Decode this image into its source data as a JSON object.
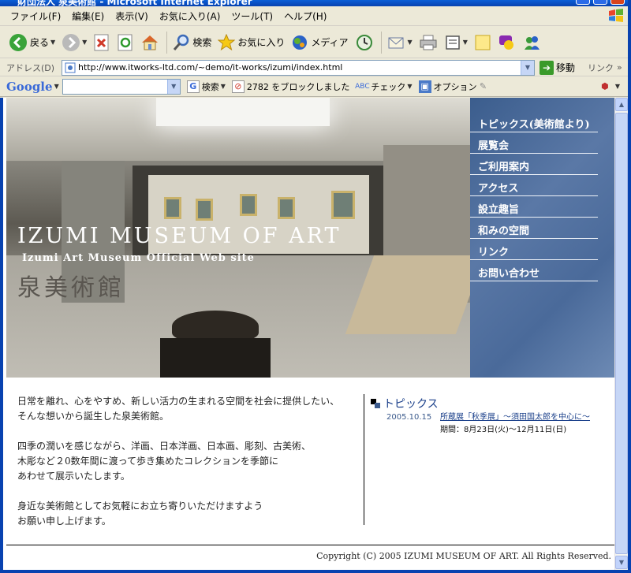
{
  "window": {
    "title": "財団法人 泉美術館 - Microsoft Internet Explorer"
  },
  "menu": [
    "ファイル(F)",
    "編集(E)",
    "表示(V)",
    "お気に入り(A)",
    "ツール(T)",
    "ヘルプ(H)"
  ],
  "toolbar": {
    "back_label": "戻る",
    "search_label": "検索",
    "favorites_label": "お気に入り",
    "media_label": "メディア"
  },
  "address": {
    "label": "アドレス(D)",
    "url": "http://www.itworks-ltd.com/~demo/it-works/izumi/index.html",
    "go_label": "移動",
    "links_label": "リンク"
  },
  "google_bar": {
    "logo": "Google",
    "search_label": "検索",
    "popup_blocked": "2782 をブロックしました",
    "check_label": "チェック",
    "options_label": "オプション"
  },
  "hero": {
    "logo_en": "IZUMI MUSEUM OF ART",
    "logo_sub": "Izumi Art Museum Official Web site",
    "logo_jp": "泉美術館"
  },
  "nav": [
    "トピックス(美術館より)",
    "展覧会",
    "ご利用案内",
    "アクセス",
    "設立趣旨",
    "和みの空間",
    "リンク",
    "お問い合わせ"
  ],
  "intro": {
    "p1": [
      "日常を離れ、心をやすめ、新しい活力の生まれる空間を社会に提供したい、",
      "そんな想いから誕生した泉美術館。"
    ],
    "p2": [
      "四季の潤いを感じながら、洋画、日本洋画、日本画、彫刻、古美術、",
      "木彫など２0数年間に渡って歩き集めたコレクションを季節に",
      "あわせて展示いたします。"
    ],
    "p3": [
      "身近な美術館としてお気軽にお立ち寄りいただけますよう",
      "お願い申し上げます。"
    ]
  },
  "topics": {
    "heading": "トピックス",
    "items": [
      {
        "date": "2005.10.15",
        "link": "所蔵展「秋季展」～須田国太郎を中心に～",
        "sub": "期間：8月23日(火)～12月11日(日)"
      }
    ]
  },
  "footer": {
    "copyright": "Copyright (C) 2005 IZUMI MUSEUM OF ART. All Rights Reserved."
  },
  "colors": {
    "nav_bg": "#4a6a9a",
    "link": "#1a3f8a",
    "xp_blue": "#0842b0"
  }
}
